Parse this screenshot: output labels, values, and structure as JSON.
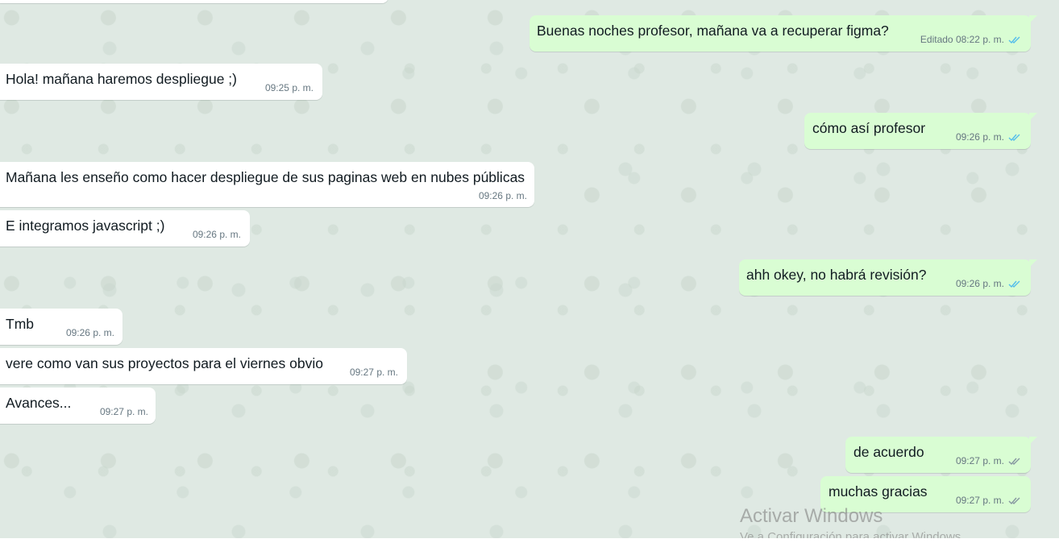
{
  "messages": [
    {
      "text": "Buenas noches profesor, mañana va a recuperar figma?",
      "edited": "Editado",
      "time": "08:22 p. m.",
      "direction": "outgoing",
      "status": "read"
    },
    {
      "text": "Hola! mañana haremos despliegue ;)",
      "time": "09:25 p. m.",
      "direction": "incoming"
    },
    {
      "text": "cómo así profesor",
      "time": "09:26 p. m.",
      "direction": "outgoing",
      "status": "read"
    },
    {
      "text": "Mañana les enseño como hacer despliegue de sus paginas web en nubes públicas",
      "time": "09:26 p. m.",
      "direction": "incoming"
    },
    {
      "text": "E integramos javascript ;)",
      "time": "09:26 p. m.",
      "direction": "incoming"
    },
    {
      "text": "ahh okey, no habrá revisión?",
      "time": "09:26 p. m.",
      "direction": "outgoing",
      "status": "read"
    },
    {
      "text": "Tmb",
      "time": "09:26 p. m.",
      "direction": "incoming"
    },
    {
      "text": "vere como van sus proyectos para el viernes obvio",
      "time": "09:27 p. m.",
      "direction": "incoming"
    },
    {
      "text": "Avances...",
      "time": "09:27 p. m.",
      "direction": "incoming"
    },
    {
      "text": "de acuerdo",
      "time": "09:27 p. m.",
      "direction": "outgoing",
      "status": "delivered"
    },
    {
      "text": "muchas gracias",
      "time": "09:27 p. m.",
      "direction": "outgoing",
      "status": "delivered"
    }
  ],
  "watermark": {
    "title": "Activar Windows",
    "subtitle": "Ve a Configuración para activar Windows."
  },
  "colors": {
    "incoming_bubble": "#ffffff",
    "outgoing_bubble": "#d9fdd3",
    "chat_background": "#dfe9e3",
    "read_tick": "#53bdeb",
    "delivered_tick": "#8696a0",
    "meta_text": "#667781"
  }
}
